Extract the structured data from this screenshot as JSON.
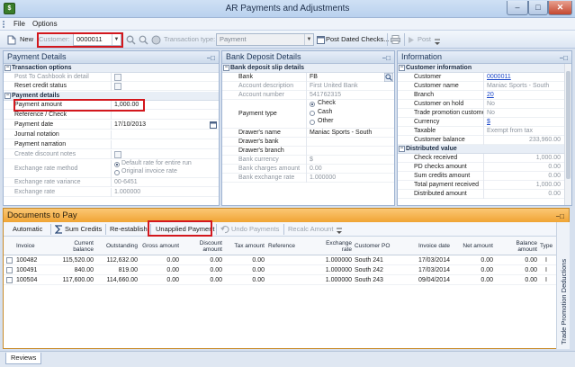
{
  "window": {
    "title": "AR Payments and Adjustments",
    "app_icon_glyph": "$"
  },
  "menu": {
    "items": [
      "File",
      "Options"
    ]
  },
  "toolbar": {
    "new_label": "New",
    "customer_label": "Customer:",
    "customer_value": "0000011",
    "transaction_type_label": "Transaction type:",
    "transaction_type_value": "Payment",
    "post_dated_checks_label": "Post Dated Checks...",
    "post_label": "Post"
  },
  "payment_details": {
    "title": "Payment Details",
    "transaction_options": {
      "header": "Transaction options",
      "rows": [
        {
          "label": "Post To Cashbook in detail",
          "type": "checkbox"
        },
        {
          "label": "Reset credit status",
          "type": "checkbox"
        }
      ]
    },
    "payment_section": {
      "header": "Payment details",
      "rows": [
        {
          "label": "Payment amount",
          "value": "1,000.00"
        },
        {
          "label": "Reference / Check",
          "value": ""
        },
        {
          "label": "Payment date",
          "value": "17/10/2013"
        },
        {
          "label": "Journal notation",
          "value": ""
        },
        {
          "label": "Payment narration",
          "value": ""
        },
        {
          "label": "Create discount notes",
          "value": ""
        },
        {
          "label": "Exchange rate method",
          "value": "Default rate for entire run",
          "value2": "Original invoice rate"
        },
        {
          "label": "Exchange rate variance",
          "value": "00-6451"
        },
        {
          "label": "Exchange rate",
          "value": "1.000000"
        }
      ]
    }
  },
  "bank_deposit": {
    "title": "Bank Deposit Details",
    "header": "Bank deposit slip details",
    "bank": {
      "label": "Bank",
      "value": "FB"
    },
    "account_description": {
      "label": "Account description",
      "value": "First United Bank"
    },
    "account_number": {
      "label": "Account number",
      "value": "541762315"
    },
    "payment_type": {
      "label": "Payment type",
      "options": [
        "Check",
        "Cash",
        "Other"
      ]
    },
    "drawers_name": {
      "label": "Drawer's name",
      "value": "Maniac Sports - South"
    },
    "drawers_bank": {
      "label": "Drawer's bank",
      "value": ""
    },
    "drawers_branch": {
      "label": "Drawer's branch",
      "value": ""
    },
    "bank_currency": {
      "label": "Bank currency",
      "value": "$"
    },
    "bank_charges_amount": {
      "label": "Bank charges amount",
      "value": "0.00"
    },
    "bank_exchange_rate": {
      "label": "Bank exchange rate",
      "value": "1.000000"
    }
  },
  "information": {
    "title": "Information",
    "customer_info": {
      "header": "Customer information",
      "rows": [
        {
          "label": "Customer",
          "value": "0000011"
        },
        {
          "label": "Customer name",
          "value": "Maniac Sports - South"
        },
        {
          "label": "Branch",
          "value": "20"
        },
        {
          "label": "Customer on hold",
          "value": "No"
        },
        {
          "label": "Trade promotion custome",
          "value": "No"
        },
        {
          "label": "Currency",
          "value": "$"
        },
        {
          "label": "Taxable",
          "value": "Exempt from tax"
        },
        {
          "label": "Customer balance",
          "value": "233,960.00"
        }
      ]
    },
    "distributed_value": {
      "header": "Distributed value",
      "rows": [
        {
          "label": "Check received",
          "value": "1,000.00"
        },
        {
          "label": "PD checks amount",
          "value": "0.00"
        },
        {
          "label": "Sum credits amount",
          "value": "0.00"
        },
        {
          "label": "Total payment received",
          "value": "1,000.00"
        },
        {
          "label": "Distributed amount",
          "value": "0.00"
        }
      ]
    }
  },
  "documents": {
    "title": "Documents to Pay",
    "buttons": {
      "automatic": "Automatic",
      "sum_credits": "Sum Credits",
      "re_establish": "Re-establish",
      "unapplied_payment": "Unapplied Payment",
      "undo_payments": "Undo Payments",
      "recalc_amount": "Recalc Amount"
    },
    "columns": [
      "Invoice",
      "Current balance",
      "Outstanding",
      "Gross amount",
      "Discount amount",
      "Tax amount",
      "Reference",
      "Exchange rate",
      "Customer PO",
      "Invoice date",
      "Net amount",
      "Balance amount",
      "Type"
    ],
    "rows": [
      [
        "100482",
        "115,520.00",
        "112,632.00",
        "0.00",
        "0.00",
        "0.00",
        "",
        "1.000000",
        "South 241",
        "17/03/2014",
        "0.00",
        "0.00",
        "I"
      ],
      [
        "100491",
        "840.00",
        "819.00",
        "0.00",
        "0.00",
        "0.00",
        "",
        "1.000000",
        "South 242",
        "17/03/2014",
        "0.00",
        "0.00",
        "I"
      ],
      [
        "100504",
        "117,600.00",
        "114,660.00",
        "0.00",
        "0.00",
        "0.00",
        "",
        "1.000000",
        "South 243",
        "09/04/2014",
        "0.00",
        "0.00",
        "I"
      ]
    ],
    "side_tab": "Trade Promotion Deductions"
  },
  "status": {
    "tab": "Reviews"
  },
  "colors": {
    "highlight_border": "#d3171d",
    "docs_header": "#f0a434",
    "link": "#1a46c8"
  }
}
